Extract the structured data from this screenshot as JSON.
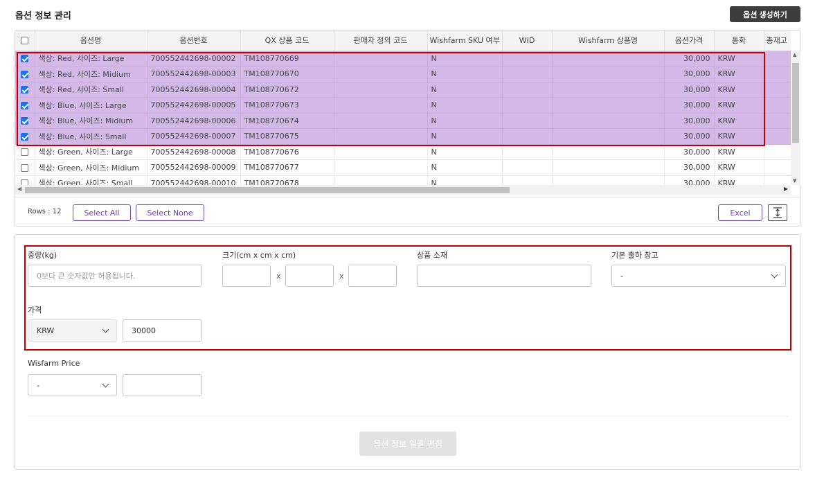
{
  "header": {
    "title": "옵션 정보 관리",
    "create_button": "옵션 생성하기"
  },
  "grid": {
    "columns": [
      "옵션명",
      "옵션번호",
      "QX 상품 코드",
      "판매자 정의 코드",
      "Wishfarm SKU 여부",
      "WID",
      "Wishfarm 상품명",
      "옵션가격",
      "통화",
      "총재고"
    ],
    "rows": [
      {
        "checked": true,
        "name": "색상: Red, 사이즈: Large",
        "option_no": "700552442698-00002",
        "qx_code": "TM108770669",
        "seller_code": "",
        "sku": "N",
        "wid": "",
        "wf_name": "",
        "price": "30,000",
        "currency": "KRW",
        "stock": ""
      },
      {
        "checked": true,
        "name": "색상: Red, 사이즈: Midium",
        "option_no": "700552442698-00003",
        "qx_code": "TM108770670",
        "seller_code": "",
        "sku": "N",
        "wid": "",
        "wf_name": "",
        "price": "30,000",
        "currency": "KRW",
        "stock": ""
      },
      {
        "checked": true,
        "name": "색상: Red, 사이즈: Small",
        "option_no": "700552442698-00004",
        "qx_code": "TM108770672",
        "seller_code": "",
        "sku": "N",
        "wid": "",
        "wf_name": "",
        "price": "30,000",
        "currency": "KRW",
        "stock": ""
      },
      {
        "checked": true,
        "name": "색상: Blue, 사이즈: Large",
        "option_no": "700552442698-00005",
        "qx_code": "TM108770673",
        "seller_code": "",
        "sku": "N",
        "wid": "",
        "wf_name": "",
        "price": "30,000",
        "currency": "KRW",
        "stock": ""
      },
      {
        "checked": true,
        "name": "색상: Blue, 사이즈: Midium",
        "option_no": "700552442698-00006",
        "qx_code": "TM108770674",
        "seller_code": "",
        "sku": "N",
        "wid": "",
        "wf_name": "",
        "price": "30,000",
        "currency": "KRW",
        "stock": ""
      },
      {
        "checked": true,
        "name": "색상: Blue, 사이즈: Small",
        "option_no": "700552442698-00007",
        "qx_code": "TM108770675",
        "seller_code": "",
        "sku": "N",
        "wid": "",
        "wf_name": "",
        "price": "30,000",
        "currency": "KRW",
        "stock": ""
      },
      {
        "checked": false,
        "name": "색상: Green, 사이즈: Large",
        "option_no": "700552442698-00008",
        "qx_code": "TM108770676",
        "seller_code": "",
        "sku": "N",
        "wid": "",
        "wf_name": "",
        "price": "30,000",
        "currency": "KRW",
        "stock": ""
      },
      {
        "checked": false,
        "name": "색상: Green, 사이즈: Midium",
        "option_no": "700552442698-00009",
        "qx_code": "TM108770677",
        "seller_code": "",
        "sku": "N",
        "wid": "",
        "wf_name": "",
        "price": "30,000",
        "currency": "KRW",
        "stock": ""
      },
      {
        "checked": false,
        "name": "색상: Green, 사이즈: Small",
        "option_no": "700552442698-00010",
        "qx_code": "TM108770678",
        "seller_code": "",
        "sku": "N",
        "wid": "",
        "wf_name": "",
        "price": "30,000",
        "currency": "KRW",
        "stock": ""
      }
    ],
    "footer": {
      "rows_label": "Rows : 12",
      "select_all": "Select All",
      "select_none": "Select None",
      "excel": "Excel"
    }
  },
  "form": {
    "weight": {
      "label": "중량(kg)",
      "placeholder": "0보다 큰 숫자값만 허용됩니다."
    },
    "size": {
      "label": "크기(cm x cm x cm)",
      "sep": "x"
    },
    "material": {
      "label": "상품 소재"
    },
    "warehouse": {
      "label": "기본 출하 창고",
      "value": "-"
    },
    "price": {
      "label": "가격",
      "currency": "KRW",
      "value": "30000"
    },
    "wisfarm_price": {
      "label": "Wisfarm Price",
      "currency": "-",
      "value": ""
    },
    "bulk_edit_button": "옵션 정보 일괄 편집"
  },
  "colors": {
    "selected_row": "#d3b8e8",
    "highlight_border": "#c00000",
    "accent": "#6b3fb0"
  }
}
